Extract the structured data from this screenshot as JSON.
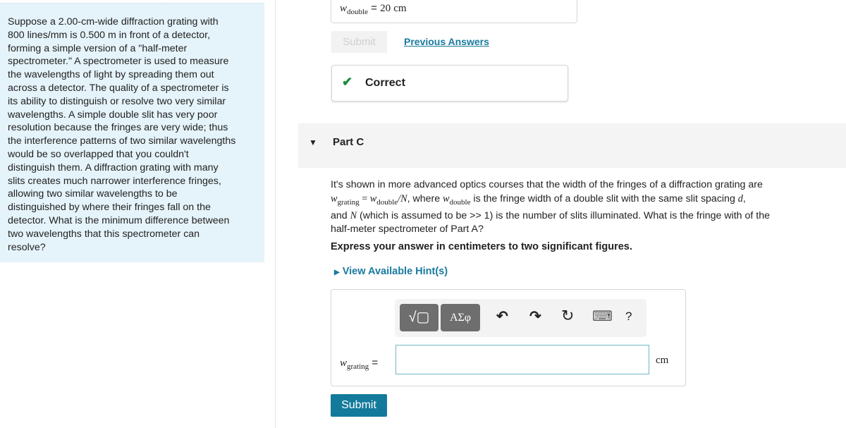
{
  "problem": {
    "text": "Suppose a 2.00-cm-wide diffraction grating with\n800 lines/mm is 0.500 m in front of a detector,\nforming a simple version of a \"half-meter\nspectrometer.\" A spectrometer is used to measure\nthe wavelengths of light by spreading them out\nacross a detector. The quality of a spectrometer is\nits ability to distinguish or resolve two very similar\nwavelengths. A simple double slit has very poor\nresolution because the fringes are very wide; thus\nthe interference patterns of two similar wavelengths\nwould be so overlapped that you couldn't\ndistinguish them. A diffraction grating with many\nslits creates much narrower interference fringes,\nallowing two similar wavelengths to be\ndistinguished by where their fringes fall on the\ndetector. What is the minimum difference between\ntwo wavelengths that this spectrometer can\nresolve?"
  },
  "partB": {
    "var": "w",
    "sub": "double",
    "eq": "=",
    "value": "20",
    "unit": "cm",
    "submit": "Submit",
    "previous": "Previous Answers",
    "feedback": "Correct"
  },
  "partC": {
    "title": "Part C",
    "line1": "It's shown in more advanced optics courses that the width of the fringes of a diffraction grating are",
    "l2a": "w",
    "l2b": "grating",
    "l2c": " = ",
    "l2d": "w",
    "l2e": "double",
    "l2f": "/N",
    "l2g": ", where ",
    "l2h": "w",
    "l2i": "double",
    "l2j": " is the fringe width of a double slit with the same slit spacing ",
    "l2k": "d",
    "l3a": "and ",
    "l3b": "N",
    "l3c": " (which is assumed to be >> 1) is the number of slits illuminated. What is the fringe with of the",
    "line4": "half-meter spectrometer of Part A?",
    "instruction": "Express your answer in centimeters to two significant figures.",
    "hints": "View Available Hint(s)",
    "toolbar": {
      "templates": "√▢",
      "symbols": "ΑΣφ",
      "undo": "↶",
      "redo": "↷",
      "reset": "↻",
      "keyboard": "⌨",
      "help": "?"
    },
    "answer": {
      "var": "w",
      "sub": "grating",
      "eq": "=",
      "value": "",
      "unit": "cm"
    },
    "submit": "Submit"
  }
}
